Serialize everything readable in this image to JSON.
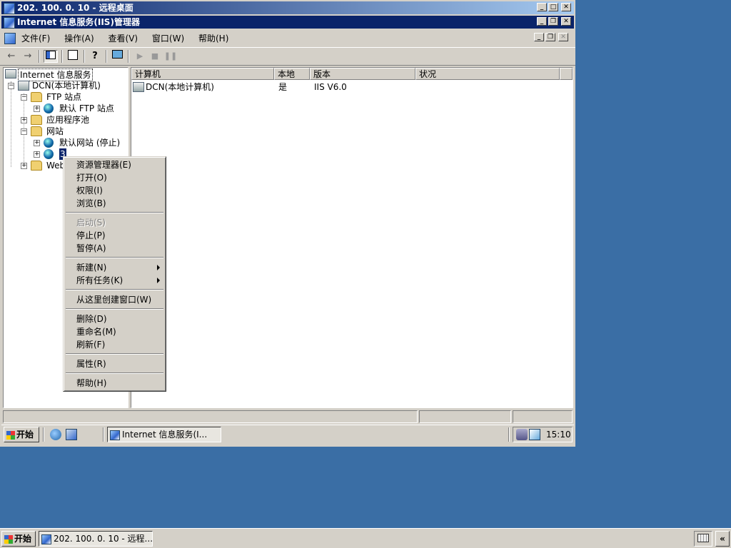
{
  "rdp_window": {
    "title": "202. 100. 0. 10 - 远程桌面"
  },
  "iis_window": {
    "title": "Internet 信息服务(IIS)管理器"
  },
  "window_buttons": {
    "minimize": "_",
    "maximize": "□",
    "restore": "❐",
    "close": "✕"
  },
  "menubar": {
    "items": [
      "文件(F)",
      "操作(A)",
      "查看(V)",
      "窗口(W)",
      "帮助(H)"
    ]
  },
  "toolbar": {
    "icons": [
      "back-arrow-icon",
      "forward-arrow-icon",
      "show-hide-tree-icon",
      "export-list-icon",
      "help-icon",
      "computer-icon",
      "play-icon",
      "stop-icon",
      "pause-icon"
    ]
  },
  "tree": {
    "root": "Internet 信息服务",
    "computer": "DCN(本地计算机)",
    "ftp_sites": "FTP 站点",
    "default_ftp": "默认 FTP 站点",
    "app_pools": "应用程序池",
    "websites": "网站",
    "default_website": "默认网站 (停止)",
    "site3": "3",
    "web_ext": "Web"
  },
  "list": {
    "columns": [
      "计算机",
      "本地",
      "版本",
      "状况"
    ],
    "rows": [
      {
        "computer": "DCN(本地计算机)",
        "local": "是",
        "version": "IIS V6.0",
        "status": ""
      }
    ]
  },
  "context_menu": {
    "explorer": "资源管理器(E)",
    "open": "打开(O)",
    "permissions": "权限(I)",
    "browse": "浏览(B)",
    "start": "启动(S)",
    "stop": "停止(P)",
    "pause": "暂停(A)",
    "new": "新建(N)",
    "all_tasks": "所有任务(K)",
    "new_window": "从这里创建窗口(W)",
    "delete": "删除(D)",
    "rename": "重命名(M)",
    "refresh": "刷新(F)",
    "properties": "属性(R)",
    "help": "帮助(H)"
  },
  "inner_taskbar": {
    "start": "开始",
    "task": "Internet 信息服务(I...",
    "clock": "15:10"
  },
  "outer_taskbar": {
    "start": "开始",
    "task": "202. 100. 0. 10 - 远程...",
    "collapse": "«"
  }
}
